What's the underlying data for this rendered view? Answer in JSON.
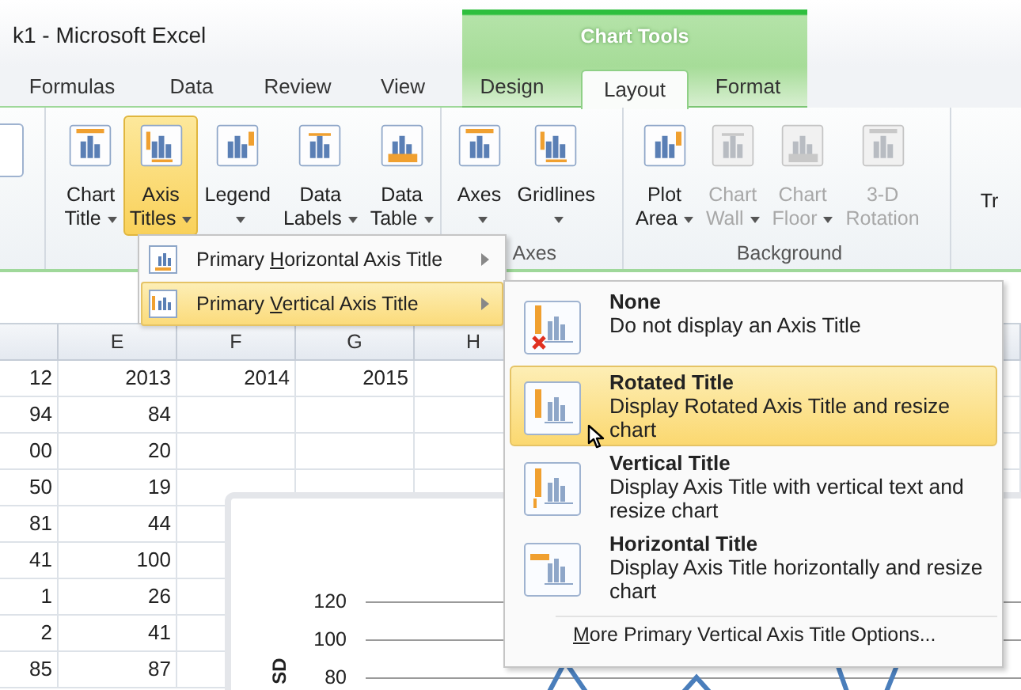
{
  "window": {
    "title": "k1 - Microsoft Excel"
  },
  "contextual_tab_group": {
    "title": "Chart Tools"
  },
  "tabs": [
    {
      "label": "Formulas",
      "selected": false,
      "contextual": false
    },
    {
      "label": "Data",
      "selected": false,
      "contextual": false
    },
    {
      "label": "Review",
      "selected": false,
      "contextual": false
    },
    {
      "label": "View",
      "selected": false,
      "contextual": false
    },
    {
      "label": "Design",
      "selected": false,
      "contextual": true
    },
    {
      "label": "Layout",
      "selected": true,
      "contextual": true
    },
    {
      "label": "Format",
      "selected": false,
      "contextual": true
    }
  ],
  "ribbon": {
    "groups": [
      {
        "buttons": [
          {
            "label_lines": [
              "Chart",
              "Title"
            ],
            "dropdown": true,
            "selected": false,
            "disabled": false
          },
          {
            "label_lines": [
              "Axis",
              "Titles"
            ],
            "dropdown": true,
            "selected": true,
            "disabled": false
          },
          {
            "label_lines": [
              "Legend"
            ],
            "dropdown": true,
            "selected": false,
            "disabled": false
          },
          {
            "label_lines": [
              "Data",
              "Labels"
            ],
            "dropdown": true,
            "selected": false,
            "disabled": false
          },
          {
            "label_lines": [
              "Data",
              "Table"
            ],
            "dropdown": true,
            "selected": false,
            "disabled": false
          }
        ]
      },
      {
        "label": "Axes",
        "buttons": [
          {
            "label_lines": [
              "Axes"
            ],
            "dropdown": true,
            "selected": false,
            "disabled": false
          },
          {
            "label_lines": [
              "Gridlines"
            ],
            "dropdown": true,
            "selected": false,
            "disabled": false
          }
        ]
      },
      {
        "label": "Background",
        "buttons": [
          {
            "label_lines": [
              "Plot",
              "Area"
            ],
            "dropdown": true,
            "selected": false,
            "disabled": false
          },
          {
            "label_lines": [
              "Chart",
              "Wall"
            ],
            "dropdown": true,
            "selected": false,
            "disabled": true
          },
          {
            "label_lines": [
              "Chart",
              "Floor"
            ],
            "dropdown": true,
            "selected": false,
            "disabled": true
          },
          {
            "label_lines": [
              "3-D",
              "Rotation"
            ],
            "dropdown": false,
            "selected": false,
            "disabled": true
          }
        ]
      },
      {
        "buttons": [
          {
            "label_lines": [
              "Tr"
            ],
            "dropdown": false,
            "selected": false,
            "disabled": false
          }
        ]
      }
    ]
  },
  "sheet": {
    "column_headers": [
      "E",
      "F",
      "G",
      "H"
    ],
    "rows": [
      {
        "column_d": "12",
        "values": [
          "2013",
          "2014",
          "2015"
        ]
      },
      {
        "column_d": "94",
        "values": [
          "84"
        ]
      },
      {
        "column_d": "00",
        "values": [
          "20"
        ]
      },
      {
        "column_d": "50",
        "values": [
          "19"
        ]
      },
      {
        "column_d": "81",
        "values": [
          "44"
        ]
      },
      {
        "column_d": "41",
        "values": [
          "100"
        ]
      },
      {
        "column_d": "1",
        "values": [
          "26"
        ]
      },
      {
        "column_d": "2",
        "values": [
          "41"
        ]
      },
      {
        "column_d": "85",
        "values": [
          "87"
        ]
      }
    ]
  },
  "chart": {
    "y_axis_title": "SD",
    "y_ticks": [
      "120",
      "100",
      "80"
    ]
  },
  "axis_titles_menu": {
    "items": [
      {
        "text_before": "Primary ",
        "access_key": "H",
        "text_after": "orizontal Axis Title",
        "selected": false,
        "submenu": true
      },
      {
        "text_before": "Primary ",
        "access_key": "V",
        "text_after": "ertical Axis Title",
        "selected": true,
        "submenu": true
      }
    ]
  },
  "vertical_axis_title_menu": {
    "options": [
      {
        "kind": "none",
        "title": "None",
        "description": "Do not display an Axis Title",
        "selected": false
      },
      {
        "kind": "rotated",
        "title": "Rotated Title",
        "description": "Display Rotated Axis Title and resize chart",
        "selected": true
      },
      {
        "kind": "vertical",
        "title": "Vertical Title",
        "description": "Display Axis Title with vertical text and resize chart",
        "selected": false
      },
      {
        "kind": "horizontal",
        "title": "Horizontal Title",
        "description": "Display Axis Title horizontally and resize chart",
        "selected": false
      }
    ],
    "more_options": {
      "access_key": "M",
      "text_after": "ore Primary Vertical Axis Title Options..."
    }
  }
}
